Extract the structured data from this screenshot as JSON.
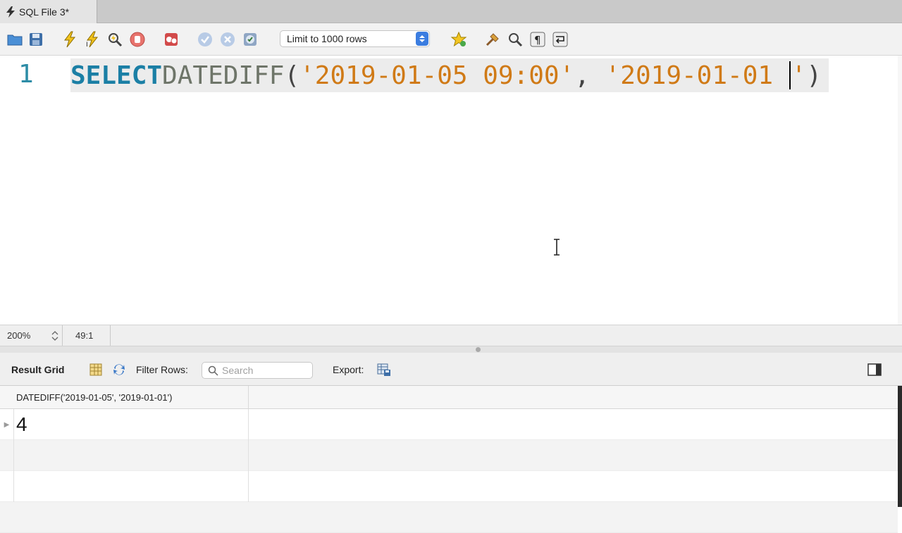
{
  "tab": {
    "title": "SQL File 3*"
  },
  "toolbar": {
    "limit_select": "Limit to 1000 rows",
    "icons": [
      "open-folder-icon",
      "save-icon",
      "execute-icon",
      "execute-current-icon",
      "explain-icon",
      "stop-icon",
      "toggle-error-icon",
      "commit-icon",
      "rollback-icon",
      "autocommit-icon",
      "snippet-star-icon",
      "beautify-icon",
      "find-icon",
      "invisibles-icon",
      "wrap-icon"
    ]
  },
  "editor": {
    "line_number": "1",
    "tokens": {
      "keyword": "SELECT",
      "function": "DATEDIFF",
      "open_paren": "(",
      "str1": "'2019-01-05 09:00'",
      "comma": ", ",
      "str2_start": "'2019-01-01 ",
      "str2_end": "'",
      "close_paren": ")"
    }
  },
  "status": {
    "zoom": "200%",
    "position": "49:1"
  },
  "results": {
    "title": "Result Grid",
    "filter_label": "Filter Rows:",
    "search_placeholder": "Search",
    "export_label": "Export:",
    "columns": [
      "DATEDIFF('2019-01-05', '2019-01-01')"
    ],
    "rows": [
      [
        "4"
      ]
    ]
  },
  "colors": {
    "keyword": "#1b7fa5",
    "string": "#d07a16",
    "function": "#6e7569",
    "select_accent": "#3b7de0"
  }
}
